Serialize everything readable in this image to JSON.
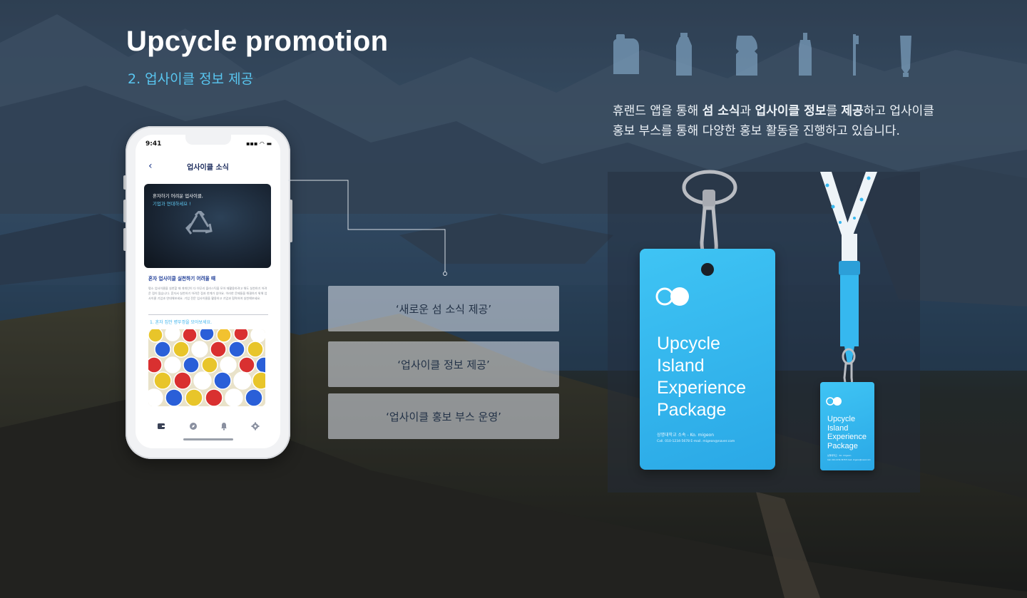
{
  "header": {
    "title": "Upcycle promotion",
    "subtitle": "2. 업사이클  정보 제공"
  },
  "description": {
    "line1_parts": [
      "휴랜드 앱을 통해 ",
      "섬 소식",
      "과 ",
      "업사이클 정보",
      "를 ",
      "제공",
      "하고 업사이클"
    ],
    "line2": "홍보 부스를 통해 다양한 홍보 활동을 진행하고 있습니다."
  },
  "icons": [
    "detergent-bottle-icon",
    "water-bottle-icon",
    "jar-icon",
    "shampoo-bottle-icon",
    "toothbrush-icon",
    "tube-icon"
  ],
  "phone": {
    "time": "9:41",
    "status_icons": "▪▪▪ ◠ ▬",
    "screen_title": "업사이클 소식",
    "back_icon": "‹",
    "hero_line1": "혼자하기 어려운 업사이클,",
    "hero_line2": "기업과 연대하세요 !",
    "section_title": "혼자 업사이클 실천하기 어려울 때",
    "paragraph": "평소 업사이클을 실천할 때 개개인이 다 아무리 플라스틱을 모아 재활용하려고 해도 실천하기 어려운 점이 많습니다. 혼자서 실천하기 어려운 점과 한계가 있어요. 이러한 문제들을 해결하기 위해 업사이클 기업과 연대해보세요. 기업 전문 업사이클을 활용하고 기업과 협력하여 실천해보세요.",
    "sub_link": "1. 혼자 집안 병뚜껑을 모아보세요.",
    "tabs": [
      "wallet-icon",
      "compass-icon",
      "bell-icon",
      "gear-icon"
    ]
  },
  "features": [
    "‘새로운 섬 소식 제공’",
    "‘업사이클 정보 제공’",
    "‘업사이클 홍보 부스 운영’"
  ],
  "badge_large": {
    "line1": "Upcycle",
    "line2": "Island",
    "line3": "Experience",
    "line4": "Package",
    "info1": "상명대학교 소속 - Ko. migeon",
    "info2": "Call. 010-1234-5678     E-mail. migeon@naver.com"
  },
  "badge_small": {
    "line1": "Upcycle",
    "line2": "Island",
    "line3": "Experience",
    "line4": "Package",
    "info1": "상명대학교 · Ko. migeon",
    "info2": "Call. 010-1234-5678   E-mail. migeon@naver.com"
  },
  "colors": {
    "accent": "#59c6f0",
    "card_blue": "#36b8ef",
    "text_dark": "#233247"
  }
}
